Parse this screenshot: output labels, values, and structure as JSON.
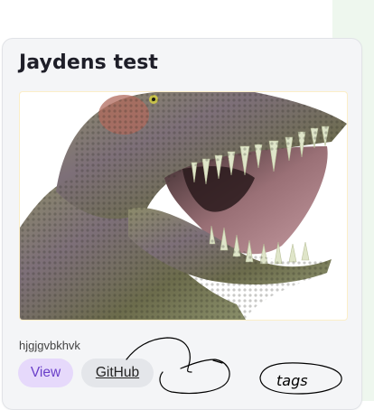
{
  "card": {
    "title": "Jaydens test",
    "image_alt": "tyrannosaurus-rex-head",
    "description": "hjgjgvbkhvk",
    "view_label": "View",
    "github_label": "GitHub"
  },
  "annotations": {
    "handwritten_note": "tags"
  },
  "colors": {
    "view_bg": "#e6d9fb",
    "view_text": "#6a3fc9",
    "github_bg": "#e4e6ea",
    "card_bg": "#f4f5f7"
  }
}
